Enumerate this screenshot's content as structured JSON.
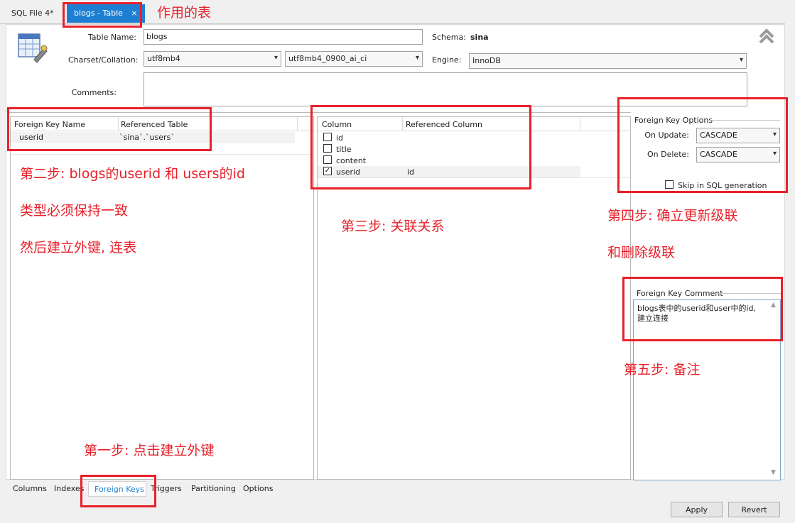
{
  "tabs": [
    {
      "label": "SQL File 4*"
    },
    {
      "label": "blogs - Table",
      "close": "×"
    }
  ],
  "form": {
    "table_name_label": "Table Name:",
    "table_name_value": "blogs",
    "schema_label": "Schema:",
    "schema_value": "sina",
    "charset_label": "Charset/Collation:",
    "charset_value": "utf8mb4",
    "collation_value": "utf8mb4_0900_ai_ci",
    "engine_label": "Engine:",
    "engine_value": "InnoDB",
    "comments_label": "Comments:",
    "collapse_icon": "double-chevron-up"
  },
  "fk_grid": {
    "headers": [
      "Foreign Key Name",
      "Referenced Table"
    ],
    "rows": [
      {
        "name": "userid",
        "ref_table": "`sina`.`users`"
      }
    ]
  },
  "col_grid": {
    "headers": [
      "Column",
      "Referenced Column"
    ],
    "rows": [
      {
        "column": "id",
        "checked": false,
        "ref": ""
      },
      {
        "column": "title",
        "checked": false,
        "ref": ""
      },
      {
        "column": "content",
        "checked": false,
        "ref": ""
      },
      {
        "column": "userid",
        "checked": true,
        "ref": "id"
      }
    ]
  },
  "options": {
    "title": "Foreign Key Options",
    "on_update_label": "On Update:",
    "on_update_value": "CASCADE",
    "on_delete_label": "On Delete:",
    "on_delete_value": "CASCADE",
    "skip_label": "Skip in SQL generation"
  },
  "comment": {
    "title": "Foreign Key Comment",
    "value": "blogs表中的userid和user中的id, 建立连接"
  },
  "bottom_tabs": [
    "Columns",
    "Indexes",
    "Foreign Keys",
    "Triggers",
    "Partitioning",
    "Options"
  ],
  "buttons": {
    "apply": "Apply",
    "revert": "Revert"
  },
  "annotations": {
    "table_note": "作用的表",
    "step2_line1": "第二步: blogs的userid 和 users的id",
    "step2_line2": "类型必须保持一致",
    "step2_line3": "然后建立外键, 连表",
    "step3": "第三步: 关联关系",
    "step4_line1": "第四步: 确立更新级联",
    "step4_line2": "和删除级联",
    "step5": "第五步: 备注",
    "step1": "第一步: 点击建立外键"
  },
  "colors": {
    "accent": "#1e7fd2",
    "annotation": "#e8202a"
  }
}
